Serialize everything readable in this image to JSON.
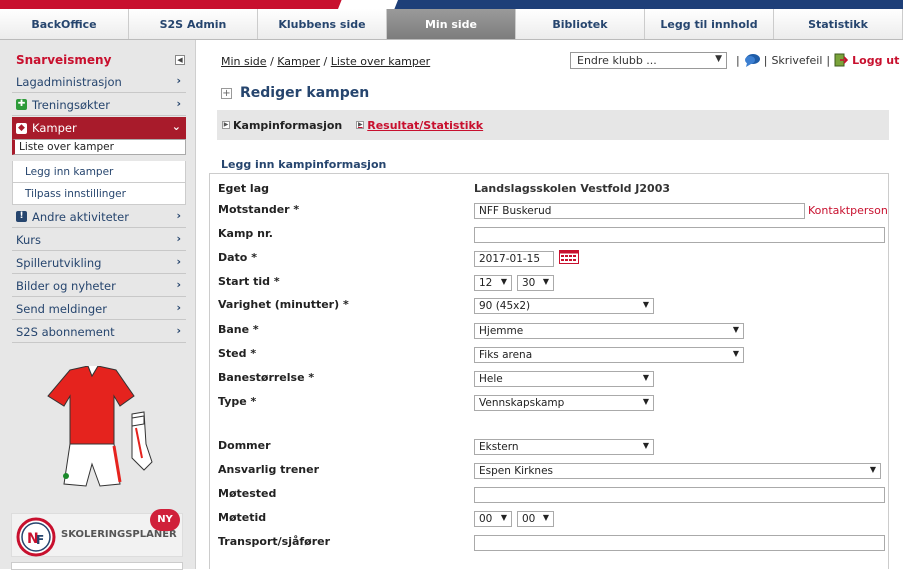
{
  "nav": {
    "tabs": [
      {
        "label": "BackOffice",
        "active": false
      },
      {
        "label": "S2S Admin",
        "active": false
      },
      {
        "label": "Klubbens side",
        "active": false
      },
      {
        "label": "Min side",
        "active": true
      },
      {
        "label": "Bibliotek",
        "active": false
      },
      {
        "label": "Legg til innhold",
        "active": false
      },
      {
        "label": "Statistikk",
        "active": false
      }
    ]
  },
  "sidebar": {
    "heading": "Snarveismeny",
    "collapse_icon": "collapse-left-icon",
    "items": [
      {
        "label": "Lagadministrasjon",
        "icon": null
      },
      {
        "label": "Treningsøkter",
        "icon": "training-icon"
      },
      {
        "label": "Kamper",
        "icon": "match-icon",
        "active": true
      },
      {
        "label": "Andre aktiviteter",
        "icon": "exclamation-icon"
      },
      {
        "label": "Kurs",
        "icon": null
      },
      {
        "label": "Spillerutvikling",
        "icon": null
      },
      {
        "label": "Bilder og nyheter",
        "icon": null
      },
      {
        "label": "Send meldinger",
        "icon": null
      },
      {
        "label": "S2S abonnement",
        "icon": null
      }
    ],
    "subitems": [
      {
        "label": "Liste over kamper",
        "selected": true
      },
      {
        "label": "Legg inn kamper",
        "selected": false
      },
      {
        "label": "Tilpass innstillinger",
        "selected": false
      }
    ],
    "promo": {
      "text": "SKOLERINGSPLANER",
      "badge": "NY"
    }
  },
  "header": {
    "breadcrumb": [
      "Min side",
      "Kamper",
      "Liste over kamper"
    ],
    "breadcrumb_sep": "/",
    "club_select": "Endre klubb ...",
    "links": {
      "pipe": "|",
      "skrivefeil": "Skrivefeil",
      "logout": "Logg ut"
    }
  },
  "page": {
    "title": "Rediger kampen",
    "subtabs": [
      {
        "label": "Kampinformasjon",
        "active": true
      },
      {
        "label": "Resultat/Statistikk",
        "active": false
      }
    ],
    "section_title": "Legg inn kampinformasjon"
  },
  "form": {
    "eget_lag": {
      "label": "Eget lag",
      "value": "Landslagsskolen Vestfold J2003"
    },
    "motstander": {
      "label": "Motstander *",
      "value": "NFF Buskerud",
      "link": "Kontaktperson"
    },
    "kamp_nr": {
      "label": "Kamp nr.",
      "value": ""
    },
    "dato": {
      "label": "Dato *",
      "value": "2017-01-15"
    },
    "start_tid": {
      "label": "Start tid *",
      "hour": "12",
      "minute": "30"
    },
    "varighet": {
      "label": "Varighet (minutter) *",
      "value": "90 (45x2)"
    },
    "bane": {
      "label": "Bane *",
      "value": "Hjemme"
    },
    "sted": {
      "label": "Sted *",
      "value": "Fiks arena"
    },
    "banestorrelse": {
      "label": "Banestørrelse *",
      "value": "Hele"
    },
    "type": {
      "label": "Type *",
      "value": "Vennskapskamp"
    },
    "dommer": {
      "label": "Dommer",
      "value": "Ekstern"
    },
    "trener": {
      "label": "Ansvarlig trener",
      "value": "Espen Kirknes"
    },
    "motested": {
      "label": "Møtested",
      "value": ""
    },
    "motetid": {
      "label": "Møtetid",
      "hour": "00",
      "minute": "00"
    },
    "transport": {
      "label": "Transport/sjåfører",
      "value": ""
    }
  },
  "colors": {
    "accent": "#c8102e",
    "nav_text": "#26456e",
    "active_side": "#a81b2b"
  }
}
